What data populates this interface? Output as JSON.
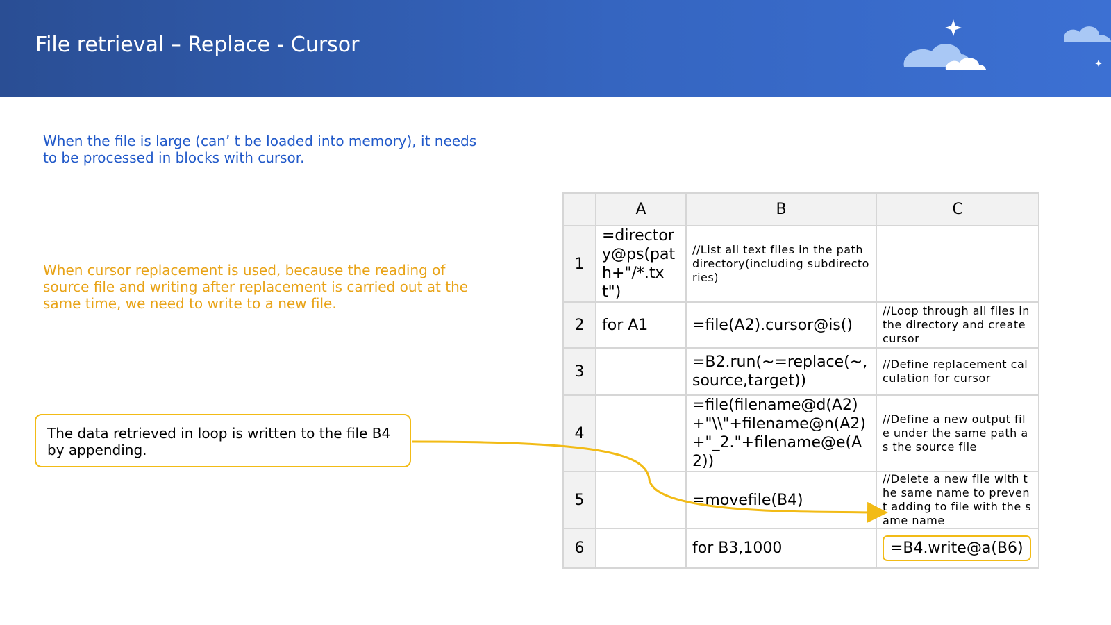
{
  "header": {
    "title": "File retrieval – Replace - Cursor"
  },
  "notes": {
    "blue": "When the file is large (can’ t be loaded into memory), it needs to be processed in blocks with cursor.",
    "orange": "When cursor replacement is used, because the reading of source file and writing after replacement is carried out at the same time, we need to write to a new file."
  },
  "callout": "The data retrieved in loop is written to the file B4 by appending.",
  "colors": {
    "banner": "#3565c0",
    "blue_text": "#2159c9",
    "orange_text": "#e8a317",
    "highlight": "#f2bb16"
  },
  "grid": {
    "columns": [
      "A",
      "B",
      "C"
    ],
    "rows": [
      {
        "n": "1",
        "a": "=directory@ps(path+\"/*.txt\")",
        "b": "//List all text files in the path directory(including subdirectories)",
        "c": ""
      },
      {
        "n": "2",
        "a": "for A1",
        "b": "=file(A2).cursor@is()",
        "c": "//Loop through all files in the directory and create cursor"
      },
      {
        "n": "3",
        "a": "",
        "b": "=B2.run(~=replace(~,source,target))",
        "c": "//Define replacement calculation for cursor"
      },
      {
        "n": "4",
        "a": "",
        "b": "=file(filename@d(A2)+\"\\\\\"+filename@n(A2)+\"_2.\"+filename@e(A2))",
        "c": "//Define a new output file under the same path as the source file"
      },
      {
        "n": "5",
        "a": "",
        "b": "=movefile(B4)",
        "c": "//Delete a new file with the same name to prevent adding to file with the same name"
      },
      {
        "n": "6",
        "a": "",
        "b": "for B3,1000",
        "c": "=B4.write@a(B6)"
      }
    ]
  }
}
